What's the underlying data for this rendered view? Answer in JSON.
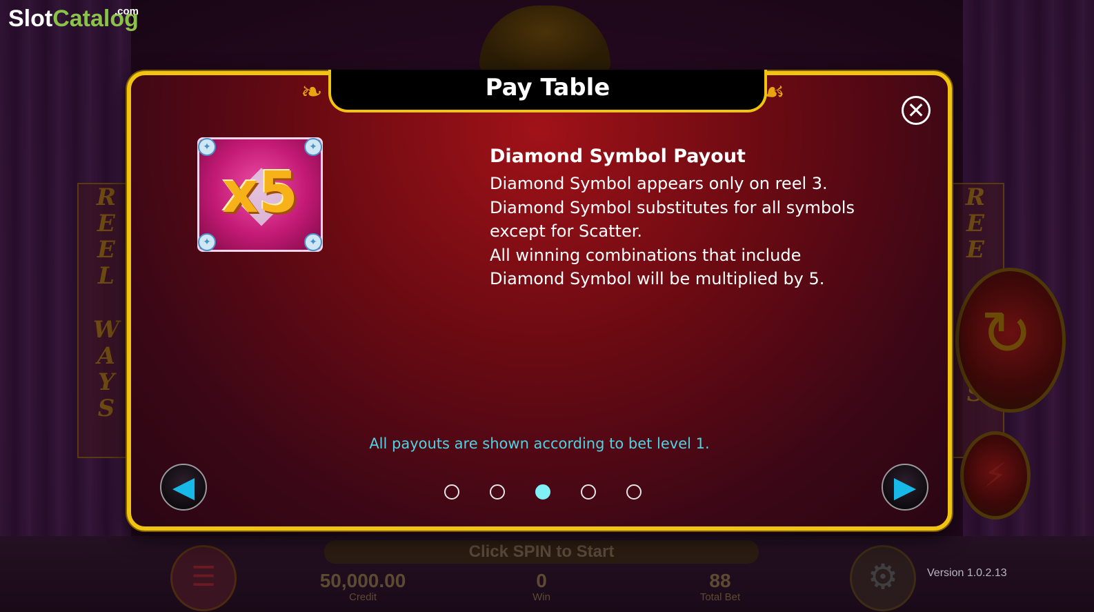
{
  "logo": {
    "slot": "Slot",
    "catalog": "Catalog",
    "com": ".com"
  },
  "background": {
    "reel_left": [
      "R",
      "E",
      "E",
      "L",
      "W",
      "A",
      "Y",
      "S"
    ],
    "reel_right": [
      "R",
      "E",
      "E",
      "S"
    ],
    "spin_message": "Click SPIN to Start",
    "credit_value": "50,000.00",
    "credit_label": "Credit",
    "win_value": "0",
    "win_label": "Win",
    "total_bet_value": "88",
    "total_bet_label": "Total Bet",
    "version": "Version 1.0.2.13"
  },
  "modal": {
    "title": "Pay Table",
    "close_icon": "close-icon",
    "symbol": {
      "multiplier": "x5",
      "icon": "diamond-icon"
    },
    "info_title": "Diamond Symbol Payout",
    "info_lines": [
      "Diamond Symbol appears only on reel 3.",
      "Diamond Symbol substitutes for all symbols",
      "except for Scatter.",
      "All winning combinations that include",
      "Diamond Symbol will be multiplied by 5."
    ],
    "note": "All payouts are shown according to bet level 1.",
    "pagination": {
      "total": 5,
      "current": 3
    },
    "prev_icon": "arrow-left-icon",
    "next_icon": "arrow-right-icon"
  },
  "colors": {
    "frame_gold": "#f1c40f",
    "accent_cyan": "#4fd3e4",
    "logo_green": "#8bc34a"
  }
}
